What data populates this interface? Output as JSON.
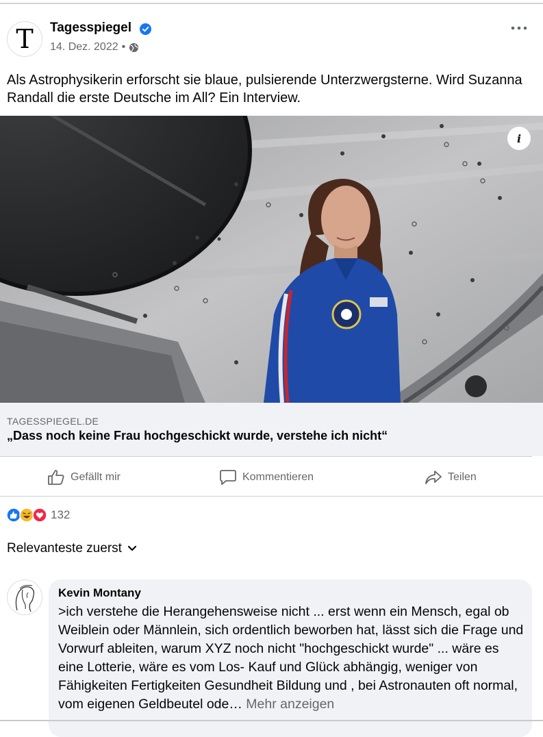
{
  "post": {
    "page_name": "Tagesspiegel",
    "date": "14. Dez. 2022",
    "separator": "•",
    "logo_letter": "T",
    "text": "Als Astrophysikerin erforscht sie blaue, pulsierende Unterzwergsterne. Wird Suzanna Randall die erste Deutsche im All? Ein Interview."
  },
  "photo": {
    "alt": "Suzanna Randall in blue flight suit",
    "info_label": "i"
  },
  "link": {
    "domain": "TAGESSPIEGEL.DE",
    "title": "„Dass noch keine Frau hochgeschickt wurde, verstehe ich nicht“"
  },
  "actions": {
    "like_label": "Gefällt mir",
    "comment_label": "Kommentieren",
    "share_label": "Teilen"
  },
  "reactions": {
    "count": "132",
    "types": [
      "like-icon",
      "haha-icon",
      "love-icon"
    ]
  },
  "sort": {
    "label": "Relevanteste zuerst"
  },
  "comment": {
    "author": "Kevin Montany",
    "text": ">ich verstehe die Herangehensweise nicht ... erst wenn ein Mensch, egal ob Weiblein oder Männlein, sich ordentlich beworben hat, lässt sich die Frage und Vorwurf ableiten, warum XYZ noch nicht \"hochgeschickt wurde\" ... wäre es eine Lotterie, wäre es vom Los- Kauf und Glück abhängig, weniger von Fähigkeiten Fertigkeiten Gesundheit Bildung und , bei Astronauten oft normal, vom eigenen Geldbeutel ode…",
    "more_label": "Mehr anzeigen"
  },
  "colors": {
    "accent": "#1877f2",
    "secondary_text": "#65676b",
    "bubble": "#f0f2f5"
  }
}
